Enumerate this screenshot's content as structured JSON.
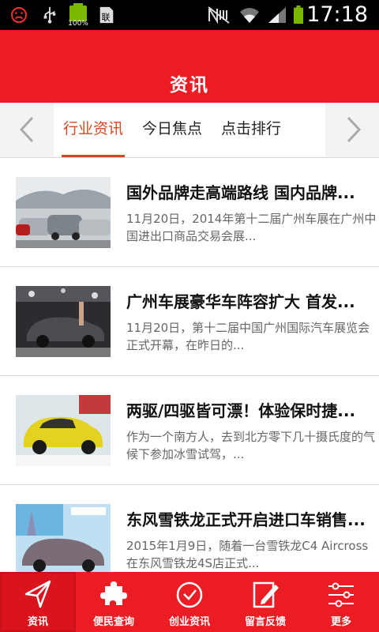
{
  "status_bar": {
    "time": "17:18",
    "battery_label": "100%",
    "icons": [
      "sad-face-icon",
      "usb-icon",
      "battery-icon",
      "sim-card-icon",
      "mute-icon",
      "wifi-icon",
      "signal-icon",
      "battery-full-icon"
    ]
  },
  "header": {
    "title": "资讯"
  },
  "tabs": [
    {
      "label": "行业资讯",
      "active": true
    },
    {
      "label": "今日焦点",
      "active": false
    },
    {
      "label": "点击排行",
      "active": false
    }
  ],
  "articles": [
    {
      "title": "国外品牌走高端路线 国内品牌...",
      "desc": "11月20日，2014年第十二届广州车展在广州中国进出口商品交易会展..."
    },
    {
      "title": "广州车展豪华车阵容扩大 首发...",
      "desc": " 11月20日，第十二届中国广州国际汽车展览会正式开幕，在昨日的..."
    },
    {
      "title": "两驱/四驱皆可漂！体验保时捷...",
      "desc": "作为一个南方人，去到北方零下几十摄氏度的气候下参加冰雪试驾，..."
    },
    {
      "title": "东风雪铁龙正式开启进口车销售...",
      "desc": "2015年1月9日，随着一台雪铁龙C4 Aircross在东风雪铁龙4S店正式..."
    }
  ],
  "bottom_nav": [
    {
      "label": "资讯",
      "icon": "send-icon",
      "active": true
    },
    {
      "label": "便民查询",
      "icon": "puzzle-icon",
      "active": false
    },
    {
      "label": "创业资讯",
      "icon": "clock-icon",
      "active": false
    },
    {
      "label": "留言反馈",
      "icon": "edit-icon",
      "active": false
    },
    {
      "label": "更多",
      "icon": "sliders-icon",
      "active": false
    }
  ],
  "colors": {
    "brand_red": "#ec1c24",
    "active_tab": "#d24a1e"
  }
}
